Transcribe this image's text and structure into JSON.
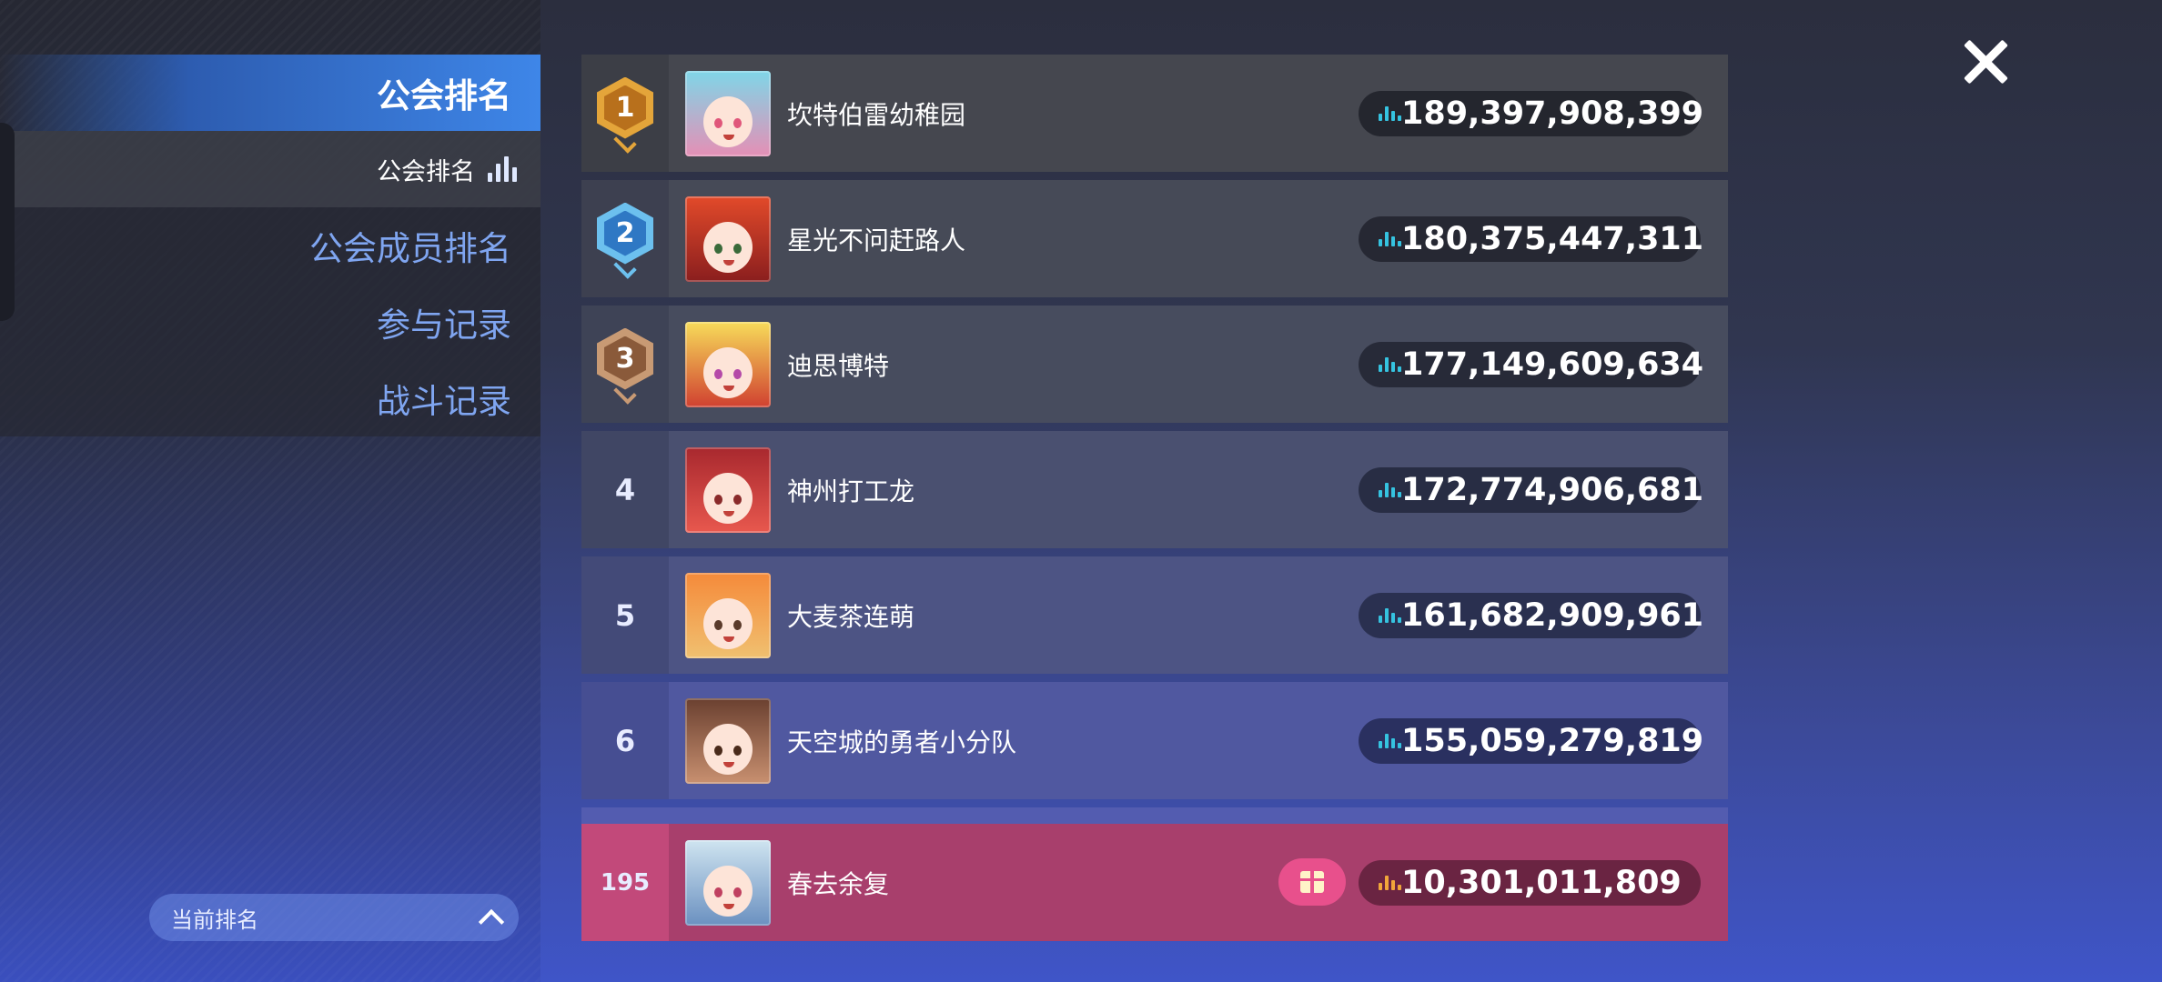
{
  "sidebar": {
    "main_tab": "公会排名",
    "sub_tab": "公会排名",
    "items": [
      {
        "label": "公会成员排名"
      },
      {
        "label": "参与记录"
      },
      {
        "label": "战斗记录"
      }
    ],
    "current_rank_label": "当前排名"
  },
  "ranking": {
    "rows": [
      {
        "rank": "1",
        "name": "坎特伯雷幼稚园",
        "score": "189,397,908,399"
      },
      {
        "rank": "2",
        "name": "星光不问赶路人",
        "score": "180,375,447,311"
      },
      {
        "rank": "3",
        "name": "迪思博特",
        "score": "177,149,609,634"
      },
      {
        "rank": "4",
        "name": "神州打工龙",
        "score": "172,774,906,681"
      },
      {
        "rank": "5",
        "name": "大麦茶连萌",
        "score": "161,682,909,961"
      },
      {
        "rank": "6",
        "name": "天空城的勇者小分队",
        "score": "155,059,279,819"
      }
    ],
    "self": {
      "rank": "195",
      "name": "春去余复",
      "score": "10,301,011,809"
    }
  },
  "colors": {
    "gold": "#d28a2a",
    "silver": "#3f8fd6",
    "bronze": "#9a6a4a",
    "self_row": "#b5406e",
    "score_icon": "#35c3e0",
    "self_score_icon": "#f0a63a"
  },
  "icons": {
    "close": "close-icon",
    "chart": "bar-chart-icon",
    "gift": "gift-icon",
    "chevron": "chevron-up-icon"
  }
}
